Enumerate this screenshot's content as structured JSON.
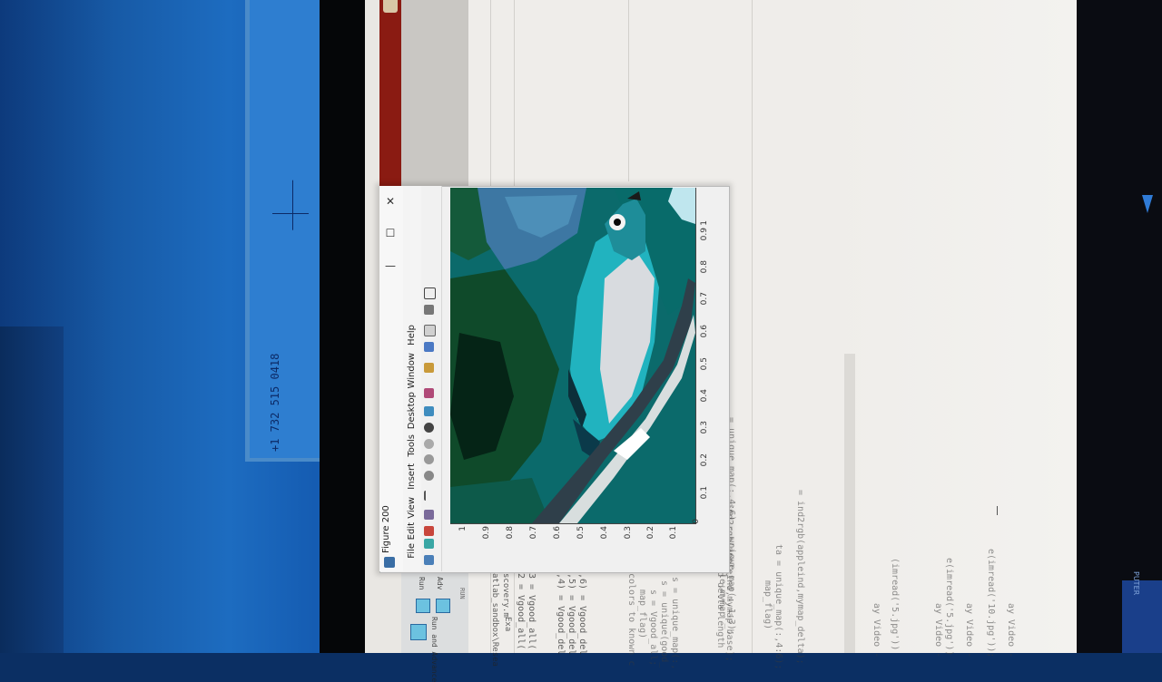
{
  "environment": {
    "whiteboard_number": "+1 732 515 0418"
  },
  "figure": {
    "title": "Figure 200",
    "window_buttons": {
      "close": "✕",
      "maximize": "☐",
      "minimize": "—"
    },
    "menu": [
      "File",
      "Edit",
      "View",
      "Insert",
      "Tools",
      "Desktop",
      "Window",
      "Help"
    ],
    "x_ticks": [
      "0",
      "0.1",
      "0.2",
      "0.3",
      "0.4",
      "0.5",
      "0.6",
      "0.7",
      "0.8",
      "0.9",
      "1"
    ],
    "y_ticks": [
      "0",
      "0.1",
      "0.2",
      "0.3",
      "0.4",
      "0.5",
      "0.6",
      "0.7",
      "0.8",
      "0.9",
      "1"
    ]
  },
  "editor": {
    "code_lines": [
      "2 = Vgood_all(",
      "3 = Vgood_all(",
      ",4) = Vgood_del",
      ",5) = Vgood_del",
      ",6) = Vgood_del",
      "colors to known c",
      "map_flag)",
      "s = Vgood_all;",
      "s = unique(good_",
      "s = unique_map(:,",
      "lized delta length",
      "= unique_map(:,4:6) - unique_map(:,1:3);",
      "map_flag)",
      "ta = unique_map(:,4:6);",
      "= ind2rgb(appleind,mymap_delta);",
      "ind(apple,mymap",
      "ind2rgb(appleind,mymap_base);",
      "ay Video -",
      "(imread('5.jpg'))",
      "ay Video -",
      "e(imread('5.jpg'))",
      "ay Video -",
      "e(imread('10.jpg'));",
      "ay Video -"
    ],
    "tabs": [
      "Run",
      "Adv",
      "Exa"
    ],
    "file_path": "atlab_sandbox\\Resea",
    "file_name": "scovery.m",
    "toolstrip": {
      "run_and_advance": "Run and Advance",
      "run_label": "RUN"
    }
  },
  "bezel_text": "PUTER"
}
